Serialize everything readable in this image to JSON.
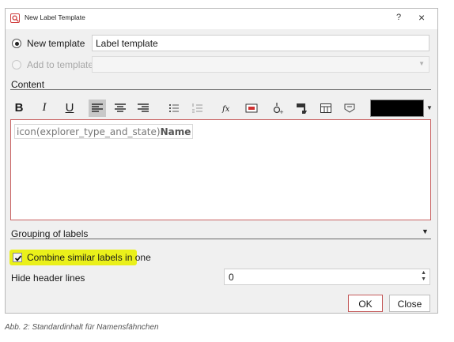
{
  "window": {
    "title": "New Label Template",
    "help_glyph": "?",
    "close_glyph": "×"
  },
  "new_template": {
    "label": "New template",
    "value": "Label template",
    "selected": true
  },
  "add_to_template": {
    "label": "Add to template",
    "value": "",
    "enabled": false
  },
  "content_section": {
    "label": "Content"
  },
  "toolbar": {
    "bold": "B",
    "italic": "I",
    "underline": "U",
    "color_value": "#000000"
  },
  "editor": {
    "function_text": "icon(explorer_type_and_state)",
    "field_text": "Name"
  },
  "grouping": {
    "label": "Grouping of labels"
  },
  "combine": {
    "label": "Combine similar labels in one",
    "checked": true
  },
  "hide_header": {
    "label": "Hide header lines",
    "value": "0"
  },
  "buttons": {
    "ok": "OK",
    "close": "Close"
  },
  "caption": "Abb. 2: Standardinhalt für Namensfähnchen",
  "colors": {
    "highlight": "#eaf01a",
    "primary_border": "#c35a5a",
    "editor_border": "#c86060"
  }
}
